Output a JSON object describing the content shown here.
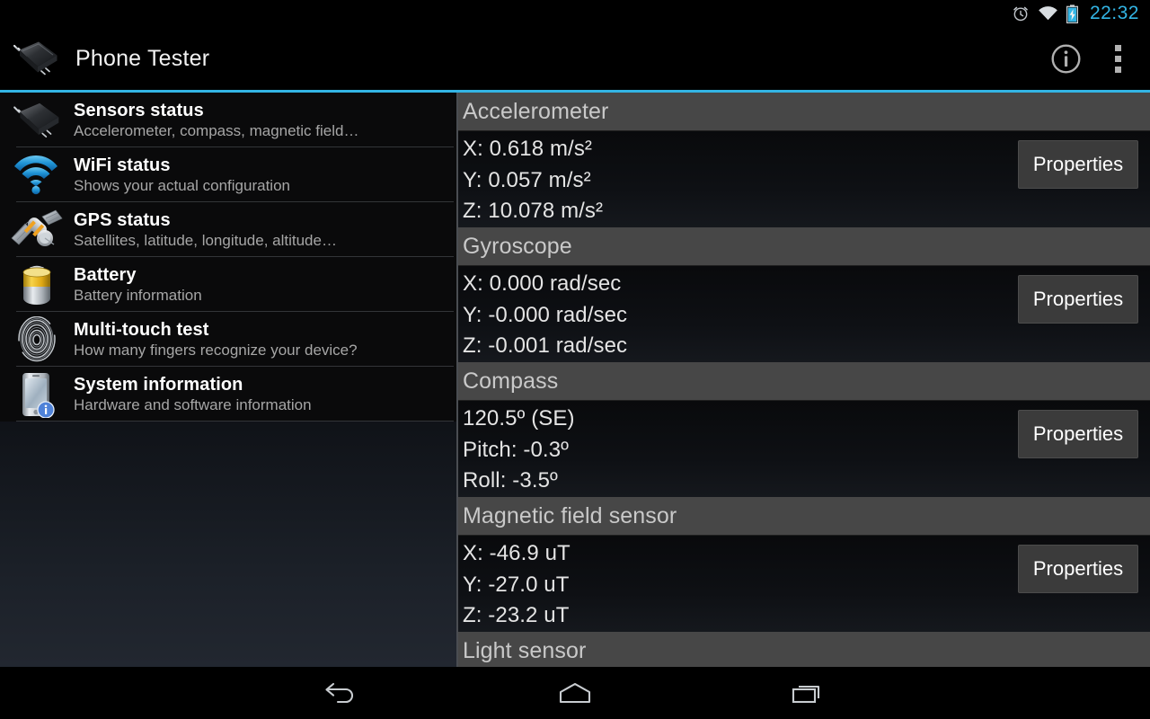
{
  "statusbar": {
    "icons": [
      "alarm-clock-icon",
      "wifi-icon",
      "battery-charging-icon"
    ],
    "time": "22:32",
    "time_color": "#33b5e5"
  },
  "actionbar": {
    "app_icon": "microchip-icon",
    "title": "Phone Tester",
    "info_label": "i",
    "actions": [
      "info-icon",
      "overflow-menu-icon"
    ],
    "accent_color": "#33b5e5"
  },
  "sidebar": {
    "items": [
      {
        "icon": "microchip-icon",
        "title": "Sensors status",
        "subtitle": "Accelerometer, compass, magnetic field…"
      },
      {
        "icon": "wifi-icon",
        "title": "WiFi status",
        "subtitle": "Shows your actual configuration"
      },
      {
        "icon": "satellite-icon",
        "title": "GPS status",
        "subtitle": "Satellites, latitude, longitude, altitude…"
      },
      {
        "icon": "battery-icon",
        "title": "Battery",
        "subtitle": "Battery information"
      },
      {
        "icon": "fingerprint-icon",
        "title": "Multi-touch test",
        "subtitle": "How many fingers recognize your device?"
      },
      {
        "icon": "smartphone-info-icon",
        "title": "System information",
        "subtitle": "Hardware and software information"
      }
    ]
  },
  "detail": {
    "button_label": "Properties",
    "sections": [
      {
        "header": "Accelerometer",
        "values": [
          "X: 0.618 m/s²",
          "Y: 0.057 m/s²",
          "Z: 10.078 m/s²"
        ],
        "has_button": true
      },
      {
        "header": "Gyroscope",
        "values": [
          "X: 0.000 rad/sec",
          "Y: -0.000 rad/sec",
          "Z: -0.001 rad/sec"
        ],
        "has_button": true
      },
      {
        "header": "Compass",
        "values": [
          "120.5º (SE)",
          "Pitch: -0.3º",
          "Roll: -3.5º"
        ],
        "has_button": true
      },
      {
        "header": "Magnetic field sensor",
        "values": [
          "X: -46.9 uT",
          "Y: -27.0 uT",
          "Z: -23.2 uT"
        ],
        "has_button": true
      },
      {
        "header": "Light sensor",
        "values": [],
        "has_button": false
      }
    ]
  },
  "navbar": {
    "buttons": [
      "back-icon",
      "home-icon",
      "recent-apps-icon"
    ]
  }
}
